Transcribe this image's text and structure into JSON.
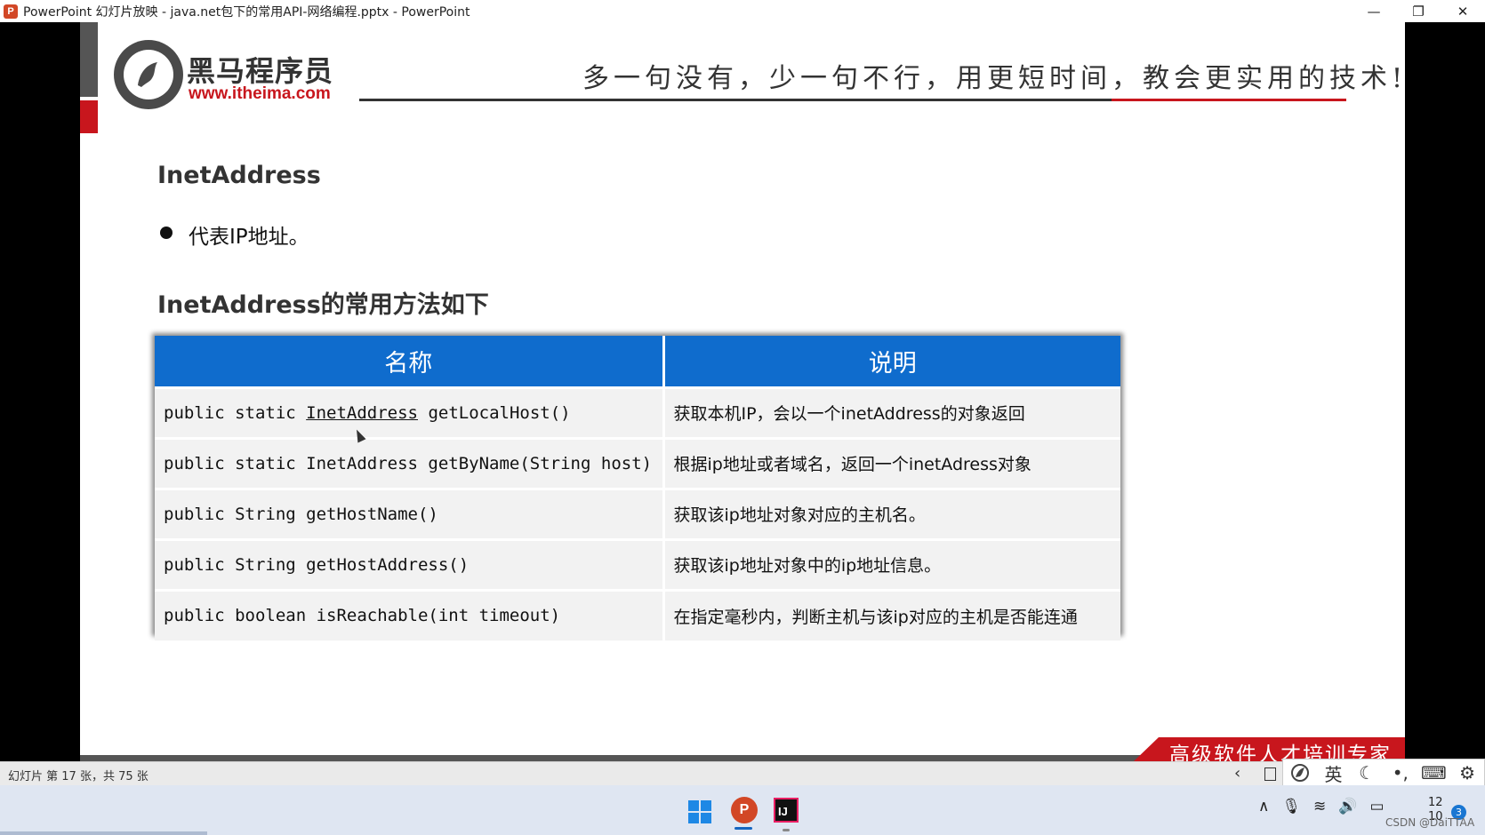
{
  "window": {
    "app_icon": "P",
    "title": "PowerPoint 幻灯片放映 - java.net包下的常用API-网络编程.pptx - PowerPoint",
    "minimize": "—",
    "restore": "❐",
    "close": "✕"
  },
  "slide": {
    "brand_cn": "黑马程序员",
    "brand_url": "www.itheima.com",
    "slogan": "多一句没有，少一句不行，用更短时间，教会更实用的技术!",
    "heading": "InetAddress",
    "bullet": "代表IP地址。",
    "subheading": "InetAddress的常用方法如下",
    "table": {
      "headers": [
        "名称",
        "说明"
      ],
      "rows": [
        {
          "name_prefix": "public static ",
          "name_type": "InetAddress",
          "name_suffix": " getLocalHost()",
          "desc": "获取本机IP，会以一个inetAddress的对象返回"
        },
        {
          "name": "public static InetAddress getByName(String host)",
          "desc": "根据ip地址或者域名，返回一个inetAdress对象"
        },
        {
          "name": "public String getHostName()",
          "desc": "获取该ip地址对象对应的主机名。"
        },
        {
          "name": "public String getHostAddress()",
          "desc": "获取该ip地址对象中的ip地址信息。"
        },
        {
          "name": "public boolean isReachable(int timeout)",
          "desc": "在指定毫秒内，判断主机与该ip对应的主机是否能连通"
        }
      ]
    },
    "footer_banner": "高级软件人才培训专家"
  },
  "statusbar": {
    "slide_info": "幻灯片 第 17 张，共 75 张",
    "prev_icon": "‹"
  },
  "ime": {
    "lang": "英",
    "moon": "☾",
    "punct": "•,",
    "keyboard": "⌨",
    "settings": "⚙"
  },
  "taskbar": {
    "ppt_label": "P",
    "idea_label": "IJ",
    "tray_up": "∧",
    "tray_mic": "🎙",
    "tray_wifi": "≋",
    "tray_sound": "🔊",
    "tray_battery": "▭",
    "clock_line1": "12",
    "clock_line2": "10",
    "notif_count": "3"
  },
  "watermark": "CSDN @DaiTTAA",
  "colors": {
    "table_header": "#0f6ccd",
    "brand_red": "#c8161d"
  }
}
